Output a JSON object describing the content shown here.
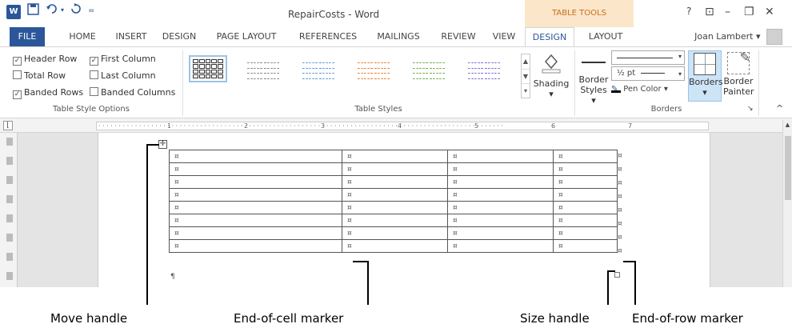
{
  "titlebar": {
    "app_icon": "W",
    "save_icon": "save-icon",
    "undo_icon": "undo-icon",
    "redo_icon": "redo-icon",
    "customize_icon": "customize-qat-icon",
    "title": "RepairCosts - Word",
    "contextual_group": "TABLE TOOLS",
    "help": "?",
    "ribbon_display": "⊡",
    "minimize": "–",
    "restore": "❐",
    "close": "✕"
  },
  "tabs": {
    "file": "FILE",
    "home": "HOME",
    "insert": "INSERT",
    "design": "DESIGN",
    "page_layout": "PAGE LAYOUT",
    "references": "REFERENCES",
    "mailings": "MAILINGS",
    "review": "REVIEW",
    "view": "VIEW",
    "table_design": "DESIGN",
    "table_layout": "LAYOUT",
    "user": "Joan Lambert",
    "user_chevron": "▾"
  },
  "ribbon": {
    "options": {
      "header_row": "Header Row",
      "first_column": "First Column",
      "total_row": "Total Row",
      "last_column": "Last Column",
      "banded_rows": "Banded Rows",
      "banded_columns": "Banded Columns",
      "check": "✓",
      "group_label": "Table Style Options"
    },
    "styles": {
      "group_label": "Table Styles",
      "thumb_colors": [
        "#333333",
        "#888888",
        "#5b9bd5",
        "#ed7d31",
        "#70ad47",
        "#7f6fd0"
      ],
      "up": "▲",
      "down": "▼",
      "more": "▾"
    },
    "shading": {
      "label": "Shading",
      "arrow": "▾"
    },
    "borders": {
      "border_styles": "Border",
      "border_styles_2": "Styles ▾",
      "weight": "½ pt",
      "pen_color": "Pen Color ▾",
      "borders": "Borders",
      "borders_arrow": "▾",
      "border_painter": "Border",
      "border_painter_2": "Painter",
      "group_label": "Borders",
      "launcher": "↘",
      "collapse": "^"
    }
  },
  "ruler": {
    "numbers": [
      "1",
      "2",
      "3",
      "4",
      "5",
      "6",
      "7"
    ]
  },
  "table": {
    "cell_marker": "¤",
    "row_marker": "¤",
    "rows": 8,
    "cols": 4,
    "paragraph_mark": "¶",
    "move_glyph": "✛"
  },
  "callouts": {
    "move_handle": "Move handle",
    "end_of_cell": "End-of-cell marker",
    "size_handle": "Size handle",
    "end_of_row": "End-of-row marker"
  }
}
